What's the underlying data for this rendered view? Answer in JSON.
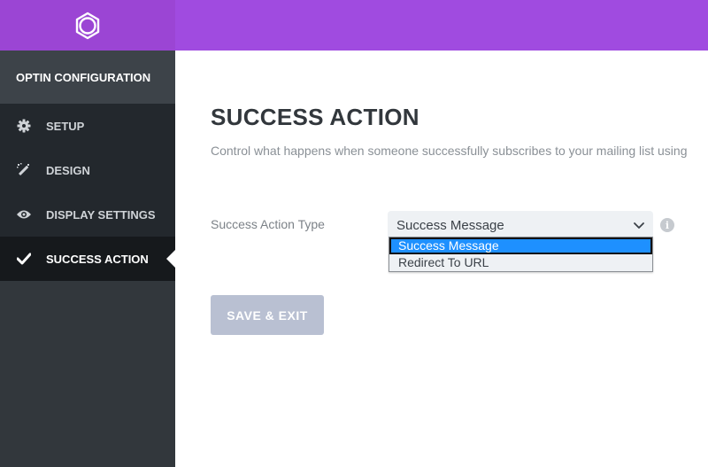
{
  "sidebar": {
    "header": "OPTIN CONFIGURATION",
    "items": [
      {
        "label": "SETUP",
        "icon": "gear-icon"
      },
      {
        "label": "DESIGN",
        "icon": "magic-wand-icon"
      },
      {
        "label": "DISPLAY SETTINGS",
        "icon": "eye-icon"
      },
      {
        "label": "SUCCESS ACTION",
        "icon": "checkmark-icon",
        "active": true
      }
    ]
  },
  "main": {
    "title": "SUCCESS ACTION",
    "description": "Control what happens when someone successfully subscribes to your mailing list using",
    "field": {
      "label": "Success Action Type",
      "value": "Success Message",
      "options": [
        "Success Message",
        "Redirect To URL"
      ]
    },
    "save_label": "SAVE & EXIT"
  },
  "colors": {
    "brand": "#a04be0",
    "sidebar_bg": "#32373c",
    "nav_bg": "#23282d",
    "active_bg": "#16191c",
    "highlight": "#1e90ff",
    "button_disabled": "#b9c0d2"
  }
}
